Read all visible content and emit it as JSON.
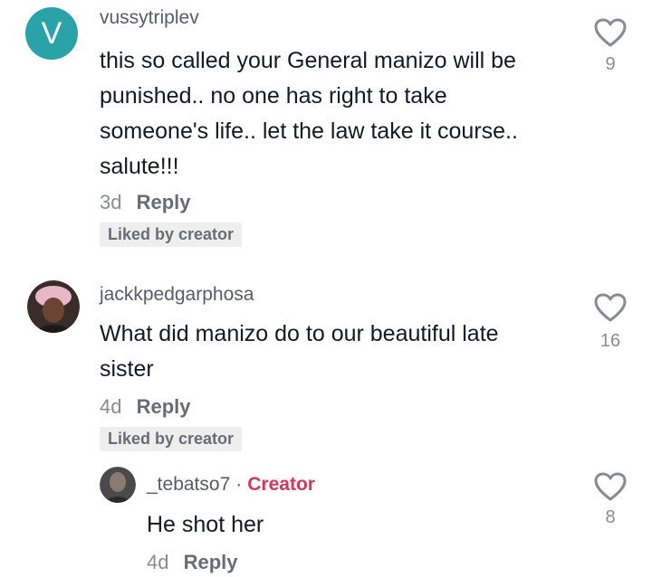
{
  "comments": [
    {
      "avatar_letter": "V",
      "avatar_color": "#2aa3a8",
      "username": "vussytriplev",
      "lines": [
        "this so called your General manizo will be",
        "punished.. no one has right to take",
        "someone's life.. let the law take it course..",
        "salute!!!"
      ],
      "time": "3d",
      "reply_label": "Reply",
      "badge": "Liked by creator",
      "likes": "9"
    },
    {
      "username": "jackkpedgarphosa",
      "lines": [
        "What did manizo do to our beautiful late",
        "sister"
      ],
      "time": "4d",
      "reply_label": "Reply",
      "badge": "Liked by creator",
      "likes": "16"
    }
  ],
  "reply": {
    "username": "_tebatso7",
    "separator": "·",
    "creator_label": "Creator",
    "creator_color": "#d1385e",
    "text": "He shot her",
    "time": "4d",
    "reply_label": "Reply",
    "likes": "8"
  },
  "icons": {
    "like": "heart-outline-icon"
  }
}
